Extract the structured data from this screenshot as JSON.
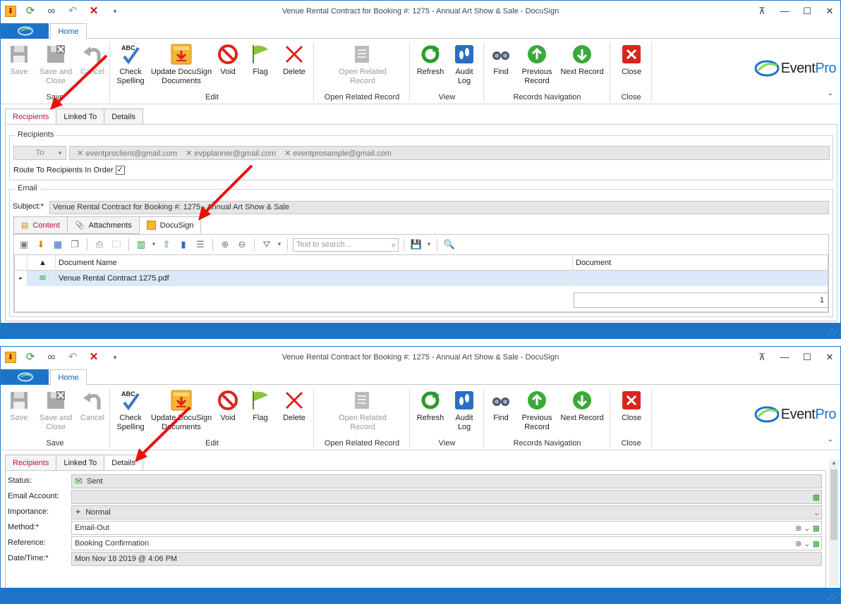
{
  "window_title": "Venue Rental Contract for Booking #: 1275 - Annual Art Show & Sale - DocuSign",
  "home_tab": "Home",
  "ribbon": {
    "save": "Save",
    "save_and_close_1": "Save and",
    "save_and_close_2": "Close",
    "cancel": "Cancel",
    "check_spelling_1": "Check",
    "check_spelling_2": "Spelling",
    "update_docusign_1": "Update DocuSign",
    "update_docusign_2": "Documents",
    "void": "Void",
    "flag": "Flag",
    "delete": "Delete",
    "open_related_1": "Open Related",
    "open_related_2": "Record",
    "refresh": "Refresh",
    "audit_log_1": "Audit",
    "audit_log_2": "Log",
    "find": "Find",
    "previous_record_1": "Previous",
    "previous_record_2": "Record",
    "next_record": "Next Record",
    "close": "Close",
    "groups": {
      "save": "Save",
      "edit": "Edit",
      "open_related": "Open Related Record",
      "view": "View",
      "records_navigation": "Records Navigation",
      "close": "Close"
    },
    "abc": "ABC",
    "logo_text_a": "E",
    "logo_text_b": "vent",
    "logo_text_c": "Pro"
  },
  "main_tabs": {
    "recipients": "Recipients",
    "linked_to": "Linked To",
    "details": "Details"
  },
  "recipients": {
    "legend": "Recipients",
    "to_button": "To",
    "tokens": [
      "eventproclient@gmail.com",
      "evpplanner@gmail.com",
      "eventprosample@gmail.com"
    ],
    "route_label": "Route To Recipients In Order"
  },
  "email": {
    "legend": "Email",
    "subject_label": "Subject:*",
    "subject_value": "Venue Rental Contract for Booking #: 1275 - Annual Art Show & Sale",
    "tabs": {
      "content": "Content",
      "attachments": "Attachments",
      "docusign": "DocuSign"
    },
    "search_placeholder": "Text to search...",
    "grid": {
      "col_document_name": "Document Name",
      "col_document": "Document",
      "rows": [
        {
          "name": "Venue Rental Contract 1275.pdf",
          "document": ""
        }
      ],
      "count": "1"
    }
  },
  "details": {
    "status_label": "Status:",
    "status_value": "Sent",
    "email_account_label": "Email Account:",
    "email_account_value": "",
    "importance_label": "Importance:",
    "importance_value": "Normal",
    "method_label": "Method:*",
    "method_value": "Email-Out",
    "reference_label": "Reference:",
    "reference_value": "Booking Confirmation",
    "datetime_label": "Date/Time:*",
    "datetime_value": "Mon Nov 18 2019 @ 4:06 PM"
  },
  "colors": {
    "accent": "#1c74c8",
    "annotation_arrow": "#e8110f",
    "active_tab_text": "#c0143c"
  }
}
